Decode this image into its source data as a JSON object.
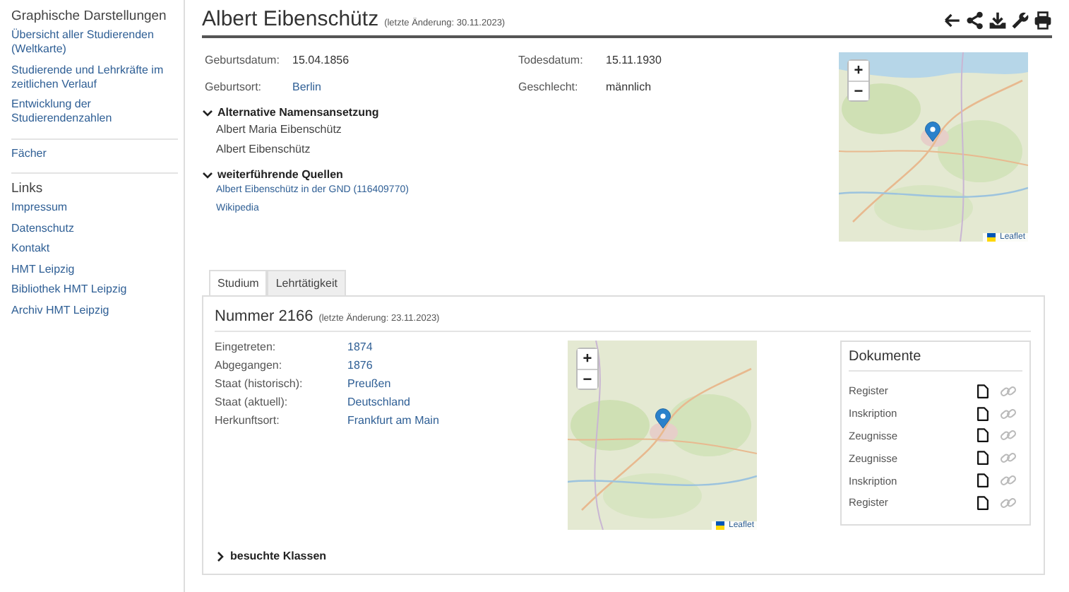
{
  "sidebar": {
    "sections": [
      {
        "heading": "Graphische Darstellungen",
        "items": [
          "Übersicht aller Studierenden (Weltkarte)",
          "Studierende und Lehrkräfte im zeitlichen Verlauf",
          "Entwicklung der Studierendenzahlen"
        ]
      },
      {
        "items": [
          "Fächer"
        ]
      },
      {
        "heading": "Links",
        "items": [
          "Impressum",
          "Datenschutz",
          "Kontakt",
          "HMT Leipzig",
          "Bibliothek HMT Leipzig",
          "Archiv HMT Leipzig"
        ]
      }
    ]
  },
  "person": {
    "name": "Albert Eibenschütz",
    "changed": "(letzte Änderung: 30.11.2023)",
    "facts": [
      {
        "label": "Geburtsdatum:",
        "value": "15.04.1856",
        "kind": "text"
      },
      {
        "label": "Todesdatum:",
        "value": "15.11.1930",
        "kind": "text"
      },
      {
        "label": "Geburtsort:",
        "value": "Berlin",
        "kind": "link"
      },
      {
        "label": "Geschlecht:",
        "value": "männlich",
        "kind": "text"
      }
    ],
    "sections": [
      {
        "title": "Alternative Namensansetzung",
        "expanded": true,
        "kind": "text",
        "items": [
          "Albert Maria Eibenschütz",
          "Albert Eibenschütz"
        ]
      },
      {
        "title": "weiterführende Quellen",
        "expanded": true,
        "kind": "link",
        "items": [
          "Albert Eibenschütz in der GND (116409770)",
          "Wikipedia"
        ]
      }
    ],
    "map": {
      "zoom_in": "+",
      "zoom_out": "−",
      "attribution": "Leaflet"
    }
  },
  "tabs": [
    {
      "label": "Studium",
      "selected": true
    },
    {
      "label": "Lehrtätigkeit",
      "selected": false
    }
  ],
  "record": {
    "title": "Nummer 2166",
    "changed": "(letzte Änderung: 23.11.2023)",
    "facts": [
      {
        "label": "Eingetreten:",
        "value": "1874"
      },
      {
        "label": "Abgegangen:",
        "value": "1876"
      },
      {
        "label": "Staat (historisch):",
        "value": "Preußen"
      },
      {
        "label": "Staat (aktuell):",
        "value": "Deutschland"
      },
      {
        "label": "Herkunftsort:",
        "value": "Frankfurt am Main"
      }
    ],
    "map": {
      "zoom_in": "+",
      "zoom_out": "−",
      "attribution": "Leaflet"
    },
    "documents": {
      "title": "Dokumente",
      "items": [
        "Register",
        "Inskription",
        "Zeugnisse",
        "Zeugnisse",
        "Inskription",
        "Register"
      ]
    },
    "classes": {
      "title": "besuchte Klassen",
      "expanded": false
    }
  }
}
